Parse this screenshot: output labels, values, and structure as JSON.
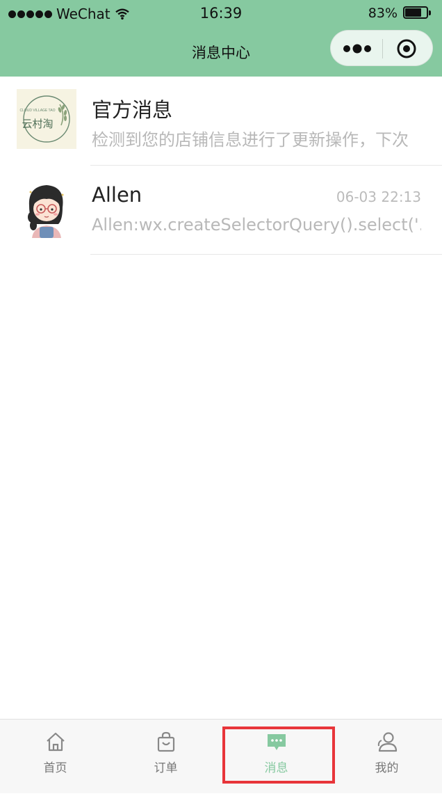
{
  "status_bar": {
    "carrier": "WeChat",
    "time": "16:39",
    "battery": "83%",
    "battery_level": 0.83
  },
  "nav": {
    "title": "消息中心",
    "more_icon": "more-dots-icon",
    "close_icon": "target-close-icon"
  },
  "messages": [
    {
      "name": "官方消息",
      "time": "",
      "preview": "检测到您的店铺信息进行了更新操作，下次",
      "logo": {
        "line1": "CLOUD VILLAGE TAO",
        "line2": "云村淘"
      }
    },
    {
      "name": "Allen",
      "time": "06-03 22:13",
      "preview": "Allen:wx.createSelectorQuery().select('.",
      "avatar": "girl-avatar"
    }
  ],
  "tabbar": {
    "tabs": [
      {
        "label": "首页",
        "icon": "home-icon"
      },
      {
        "label": "订单",
        "icon": "bag-icon"
      },
      {
        "label": "消息",
        "icon": "message-icon",
        "active": true
      },
      {
        "label": "我的",
        "icon": "user-icon"
      }
    ]
  },
  "colors": {
    "brand": "#86c9a0",
    "highlight": "#e8353a"
  }
}
